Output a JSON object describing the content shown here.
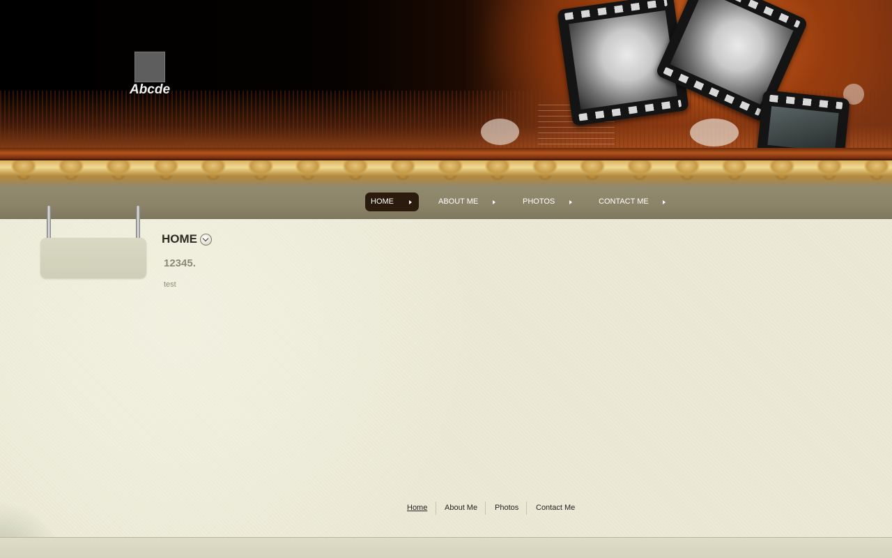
{
  "header": {
    "site_title": "Abcde",
    "logo_icon": "logo-placeholder-icon"
  },
  "nav": {
    "items": [
      {
        "label": "HOME",
        "active": true
      },
      {
        "label": "ABOUT ME",
        "active": false
      },
      {
        "label": "PHOTOS",
        "active": false
      },
      {
        "label": "CONTACT ME",
        "active": false
      }
    ]
  },
  "main": {
    "page_title": "HOME",
    "toggle_icon": "chevron-down-circle-icon",
    "post": {
      "heading": "12345.",
      "body": "test"
    }
  },
  "footer": {
    "links": [
      {
        "label": "Home",
        "active": true
      },
      {
        "label": "About Me",
        "active": false
      },
      {
        "label": "Photos",
        "active": false
      },
      {
        "label": "Contact Me",
        "active": false
      }
    ]
  },
  "colors": {
    "nav_active_bg": "#2a1b0c",
    "nav_bar": "#8b8468",
    "content_bg": "#ecead6",
    "header_accent": "#a44b18"
  }
}
